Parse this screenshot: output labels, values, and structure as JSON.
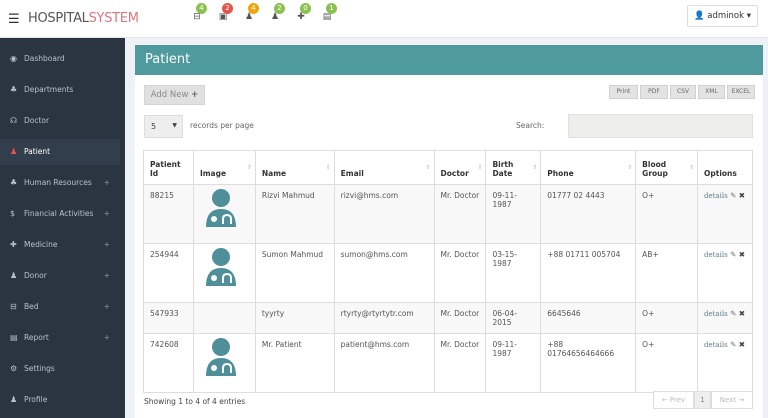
{
  "header": {
    "brand_a": "HOSPITAL",
    "brand_b": "SYSTEM",
    "user": "adminok",
    "notifications": [
      {
        "icon": "bed-icon",
        "count": "4",
        "color": "#8cc152"
      },
      {
        "icon": "money-icon",
        "count": "2",
        "color": "#e8534a"
      },
      {
        "icon": "user-icon",
        "count": "4",
        "color": "#f0a30a"
      },
      {
        "icon": "user-icon",
        "count": "2",
        "color": "#8cc152"
      },
      {
        "icon": "medkit-icon",
        "count": "0",
        "color": "#8cc152"
      },
      {
        "icon": "clipboard-icon",
        "count": "1",
        "color": "#8cc152"
      }
    ]
  },
  "sidebar": {
    "items": [
      {
        "label": "Dashboard"
      },
      {
        "label": "Departments"
      },
      {
        "label": "Doctor"
      },
      {
        "label": "Patient"
      },
      {
        "label": "Human Resources"
      },
      {
        "label": "Financial Activities"
      },
      {
        "label": "Medicine"
      },
      {
        "label": "Donor"
      },
      {
        "label": "Bed"
      },
      {
        "label": "Report"
      },
      {
        "label": "Settings"
      },
      {
        "label": "Profile"
      }
    ]
  },
  "main": {
    "title": "Patient",
    "add_new": "Add New",
    "exports": [
      "Print",
      "PDF",
      "CSV",
      "XML",
      "EXCEL"
    ],
    "page_size": "5",
    "records_per_page": "records per page",
    "search_label": "Search:",
    "columns": [
      "Patient Id",
      "Image",
      "Name",
      "Email",
      "Doctor",
      "Birth Date",
      "Phone",
      "Blood Group",
      "Options"
    ],
    "rows": [
      {
        "id": "88215",
        "name": "Rizvi Mahmud",
        "email": "rizvi@hms.com",
        "doctor": "Mr. Doctor",
        "birth": "09-11-1987",
        "phone": "01777 02 4443",
        "blood": "O+",
        "details": "details"
      },
      {
        "id": "254944",
        "name": "Sumon Mahmud",
        "email": "sumon@hms.com",
        "doctor": "Mr. Doctor",
        "birth": "03-15-1987",
        "phone": "+88 01711 005704",
        "blood": "AB+",
        "details": "details"
      },
      {
        "id": "547933",
        "name": "tyyrty",
        "email": "rtyrty@rtyrtytr.com",
        "doctor": "Mr. Doctor",
        "birth": "06-04-2015",
        "phone": "6645646",
        "blood": "O+",
        "details": "details"
      },
      {
        "id": "742608",
        "name": "Mr. Patient",
        "email": "patient@hms.com",
        "doctor": "Mr. Doctor",
        "birth": "09-11-1987",
        "phone": "+88 01764656464666",
        "blood": "O+",
        "details": "details"
      }
    ],
    "footer": "Showing 1 to 4 of 4 entries",
    "prev": "← Prev",
    "page": "1",
    "next": "Next →"
  }
}
